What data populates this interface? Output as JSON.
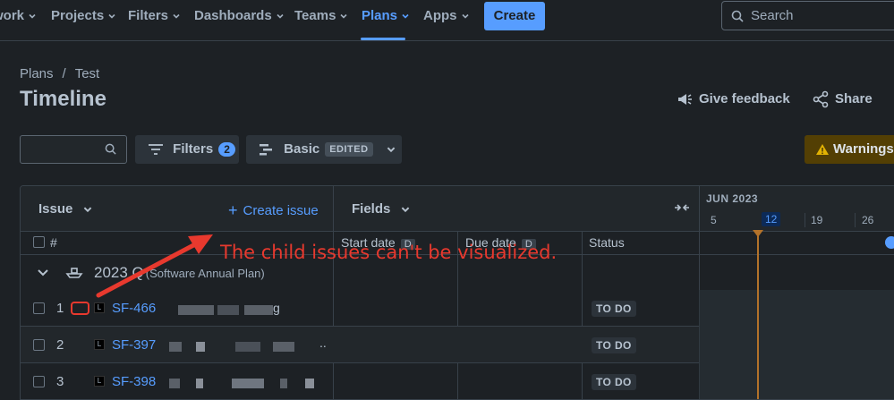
{
  "nav": {
    "items": [
      {
        "label": "work",
        "chevron": true
      },
      {
        "label": "Projects",
        "chevron": true
      },
      {
        "label": "Filters",
        "chevron": true
      },
      {
        "label": "Dashboards",
        "chevron": true
      },
      {
        "label": "Teams",
        "chevron": true
      },
      {
        "label": "Plans",
        "chevron": true,
        "active": true
      },
      {
        "label": "Apps",
        "chevron": true
      }
    ],
    "create_label": "Create",
    "search_placeholder": "Search"
  },
  "breadcrumb": [
    "Plans",
    "/",
    "Test"
  ],
  "page_title": "Timeline",
  "header_actions": {
    "feedback_label": "Give feedback",
    "share_label": "Share"
  },
  "toolbar": {
    "filters_label": "Filters",
    "filters_count": "2",
    "view_label": "Basic",
    "view_badge": "EDITED",
    "warnings_label": "Warnings"
  },
  "table": {
    "issue_header": "Issue",
    "create_issue_label": "Create issue",
    "fields_header": "Fields",
    "number_header": "#",
    "columns": [
      {
        "label": "Start date",
        "badge": "D"
      },
      {
        "label": "Due date",
        "badge": "D"
      },
      {
        "label": "Status"
      }
    ],
    "group": {
      "title": "2023 Q",
      "subtitle": "(Software Annual Plan)"
    },
    "rows": [
      {
        "num": "1",
        "key": "SF-466",
        "status": "TO DO",
        "tail": "g"
      },
      {
        "num": "2",
        "key": "SF-397",
        "status": "TO DO",
        "tail": ".."
      },
      {
        "num": "3",
        "key": "SF-398",
        "status": "TO DO",
        "tail": ""
      }
    ]
  },
  "timeline": {
    "month": "JUN 2023",
    "days": [
      "5",
      "12",
      "19",
      "26"
    ],
    "today": "12"
  },
  "annotation": {
    "text": "The child issues can't be visualized.",
    "color": "#e8392e"
  },
  "colors": {
    "accent": "#579dff",
    "background": "#1d2125",
    "warning_bg": "#533f04",
    "today_line": "#b3722a"
  }
}
